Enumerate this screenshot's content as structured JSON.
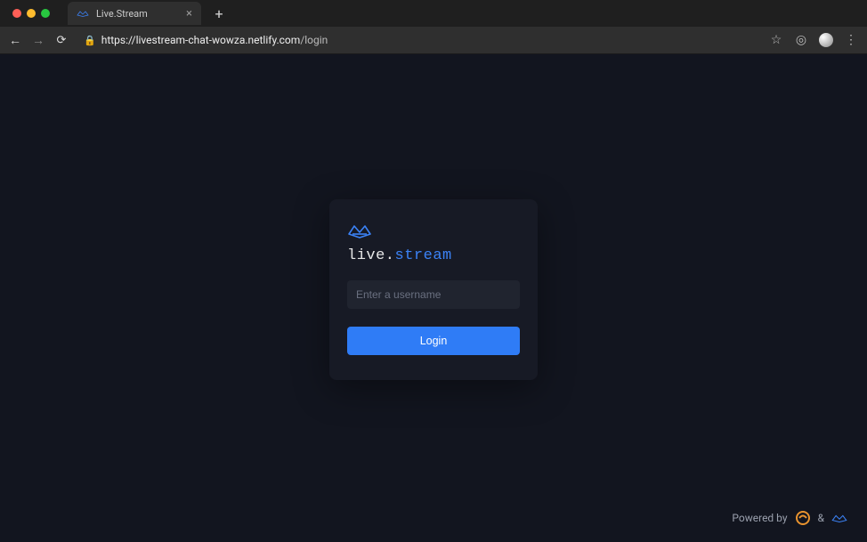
{
  "browser": {
    "tab_title": "Live.Stream",
    "url_host": "https://livestream-chat-wowza.netlify.com",
    "url_path": "/login"
  },
  "login": {
    "brand_prefix": "live.",
    "brand_suffix": "stream",
    "username_placeholder": "Enter a username",
    "username_value": "",
    "login_label": "Login"
  },
  "footer": {
    "powered_by": "Powered by",
    "amp": "&"
  },
  "colors": {
    "accent": "#2f7cf6",
    "page_bg": "#12151f",
    "card_bg": "#171a25"
  }
}
